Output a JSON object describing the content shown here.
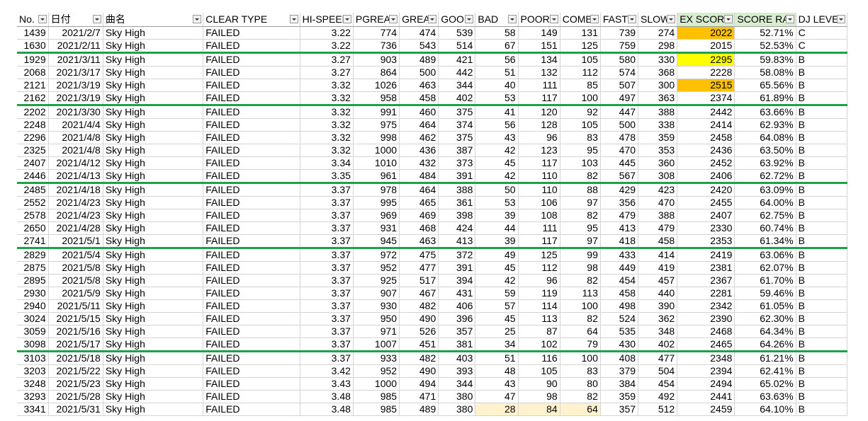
{
  "columns": [
    "No.",
    "日付",
    "曲名",
    "CLEAR TYPE",
    "HI-SPEED",
    "PGREAT",
    "GREAT",
    "GOOD",
    "BAD",
    "POOR",
    "COMBO",
    "FAST",
    "SLOW",
    "EX SCORE",
    "SCORE RATE",
    "DJ LEVEL"
  ],
  "group_separators_after_row": [
    1,
    5,
    11,
    16,
    24
  ],
  "highlight_colors": {
    "orange": "#ffc000",
    "yellow": "#ffff00",
    "cream": "#fff2cc",
    "separator": "#1fa04e",
    "header_green": "#d8ecd0"
  },
  "rows": [
    {
      "no": "1439",
      "date": "2021/2/7",
      "song": "Sky High",
      "clear": "FAILED",
      "hs": "3.22",
      "pg": "774",
      "gr": "474",
      "gd": "539",
      "bd": "58",
      "pr": "149",
      "cb": "131",
      "fast": "739",
      "slow": "274",
      "ex": "2022",
      "rate": "52.71%",
      "dj": "C",
      "ex_hl": "orange"
    },
    {
      "no": "1630",
      "date": "2021/2/11",
      "song": "Sky High",
      "clear": "FAILED",
      "hs": "3.22",
      "pg": "736",
      "gr": "543",
      "gd": "514",
      "bd": "67",
      "pr": "151",
      "cb": "125",
      "fast": "759",
      "slow": "298",
      "ex": "2015",
      "rate": "52.53%",
      "dj": "C"
    },
    {
      "no": "1929",
      "date": "2021/3/11",
      "song": "Sky High",
      "clear": "FAILED",
      "hs": "3.27",
      "pg": "903",
      "gr": "489",
      "gd": "421",
      "bd": "56",
      "pr": "134",
      "cb": "105",
      "fast": "580",
      "slow": "330",
      "ex": "2295",
      "rate": "59.83%",
      "dj": "B",
      "ex_hl": "yellow"
    },
    {
      "no": "2068",
      "date": "2021/3/17",
      "song": "Sky High",
      "clear": "FAILED",
      "hs": "3.27",
      "pg": "864",
      "gr": "500",
      "gd": "442",
      "bd": "51",
      "pr": "132",
      "cb": "112",
      "fast": "574",
      "slow": "368",
      "ex": "2228",
      "rate": "58.08%",
      "dj": "B"
    },
    {
      "no": "2121",
      "date": "2021/3/19",
      "song": "Sky High",
      "clear": "FAILED",
      "hs": "3.32",
      "pg": "1026",
      "gr": "463",
      "gd": "344",
      "bd": "40",
      "pr": "111",
      "cb": "85",
      "fast": "507",
      "slow": "300",
      "ex": "2515",
      "rate": "65.56%",
      "dj": "B",
      "ex_hl": "orange"
    },
    {
      "no": "2162",
      "date": "2021/3/19",
      "song": "Sky High",
      "clear": "FAILED",
      "hs": "3.32",
      "pg": "958",
      "gr": "458",
      "gd": "402",
      "bd": "53",
      "pr": "117",
      "cb": "100",
      "fast": "497",
      "slow": "363",
      "ex": "2374",
      "rate": "61.89%",
      "dj": "B"
    },
    {
      "no": "2202",
      "date": "2021/3/30",
      "song": "Sky High",
      "clear": "FAILED",
      "hs": "3.32",
      "pg": "991",
      "gr": "460",
      "gd": "375",
      "bd": "41",
      "pr": "120",
      "cb": "92",
      "fast": "447",
      "slow": "388",
      "ex": "2442",
      "rate": "63.66%",
      "dj": "B"
    },
    {
      "no": "2248",
      "date": "2021/4/4",
      "song": "Sky High",
      "clear": "FAILED",
      "hs": "3.32",
      "pg": "975",
      "gr": "464",
      "gd": "374",
      "bd": "56",
      "pr": "128",
      "cb": "105",
      "fast": "500",
      "slow": "338",
      "ex": "2414",
      "rate": "62.93%",
      "dj": "B"
    },
    {
      "no": "2296",
      "date": "2021/4/8",
      "song": "Sky High",
      "clear": "FAILED",
      "hs": "3.32",
      "pg": "998",
      "gr": "462",
      "gd": "375",
      "bd": "43",
      "pr": "96",
      "cb": "83",
      "fast": "478",
      "slow": "359",
      "ex": "2458",
      "rate": "64.08%",
      "dj": "B"
    },
    {
      "no": "2325",
      "date": "2021/4/8",
      "song": "Sky High",
      "clear": "FAILED",
      "hs": "3.32",
      "pg": "1000",
      "gr": "436",
      "gd": "387",
      "bd": "42",
      "pr": "123",
      "cb": "95",
      "fast": "470",
      "slow": "353",
      "ex": "2436",
      "rate": "63.50%",
      "dj": "B"
    },
    {
      "no": "2407",
      "date": "2021/4/12",
      "song": "Sky High",
      "clear": "FAILED",
      "hs": "3.34",
      "pg": "1010",
      "gr": "432",
      "gd": "373",
      "bd": "45",
      "pr": "117",
      "cb": "103",
      "fast": "445",
      "slow": "360",
      "ex": "2452",
      "rate": "63.92%",
      "dj": "B"
    },
    {
      "no": "2446",
      "date": "2021/4/13",
      "song": "Sky High",
      "clear": "FAILED",
      "hs": "3.35",
      "pg": "961",
      "gr": "484",
      "gd": "391",
      "bd": "42",
      "pr": "110",
      "cb": "82",
      "fast": "567",
      "slow": "308",
      "ex": "2406",
      "rate": "62.72%",
      "dj": "B"
    },
    {
      "no": "2485",
      "date": "2021/4/18",
      "song": "Sky High",
      "clear": "FAILED",
      "hs": "3.37",
      "pg": "978",
      "gr": "464",
      "gd": "388",
      "bd": "50",
      "pr": "110",
      "cb": "88",
      "fast": "429",
      "slow": "423",
      "ex": "2420",
      "rate": "63.09%",
      "dj": "B"
    },
    {
      "no": "2552",
      "date": "2021/4/23",
      "song": "Sky High",
      "clear": "FAILED",
      "hs": "3.37",
      "pg": "995",
      "gr": "465",
      "gd": "361",
      "bd": "53",
      "pr": "106",
      "cb": "97",
      "fast": "356",
      "slow": "470",
      "ex": "2455",
      "rate": "64.00%",
      "dj": "B"
    },
    {
      "no": "2578",
      "date": "2021/4/23",
      "song": "Sky High",
      "clear": "FAILED",
      "hs": "3.37",
      "pg": "969",
      "gr": "469",
      "gd": "398",
      "bd": "39",
      "pr": "108",
      "cb": "82",
      "fast": "479",
      "slow": "388",
      "ex": "2407",
      "rate": "62.75%",
      "dj": "B"
    },
    {
      "no": "2650",
      "date": "2021/4/28",
      "song": "Sky High",
      "clear": "FAILED",
      "hs": "3.37",
      "pg": "931",
      "gr": "468",
      "gd": "424",
      "bd": "44",
      "pr": "111",
      "cb": "95",
      "fast": "413",
      "slow": "479",
      "ex": "2330",
      "rate": "60.74%",
      "dj": "B"
    },
    {
      "no": "2741",
      "date": "2021/5/1",
      "song": "Sky High",
      "clear": "FAILED",
      "hs": "3.37",
      "pg": "945",
      "gr": "463",
      "gd": "413",
      "bd": "39",
      "pr": "117",
      "cb": "97",
      "fast": "418",
      "slow": "458",
      "ex": "2353",
      "rate": "61.34%",
      "dj": "B"
    },
    {
      "no": "2829",
      "date": "2021/5/4",
      "song": "Sky High",
      "clear": "FAILED",
      "hs": "3.37",
      "pg": "972",
      "gr": "475",
      "gd": "372",
      "bd": "49",
      "pr": "125",
      "cb": "99",
      "fast": "433",
      "slow": "414",
      "ex": "2419",
      "rate": "63.06%",
      "dj": "B"
    },
    {
      "no": "2875",
      "date": "2021/5/8",
      "song": "Sky High",
      "clear": "FAILED",
      "hs": "3.37",
      "pg": "952",
      "gr": "477",
      "gd": "391",
      "bd": "45",
      "pr": "112",
      "cb": "98",
      "fast": "449",
      "slow": "419",
      "ex": "2381",
      "rate": "62.07%",
      "dj": "B"
    },
    {
      "no": "2895",
      "date": "2021/5/8",
      "song": "Sky High",
      "clear": "FAILED",
      "hs": "3.37",
      "pg": "925",
      "gr": "517",
      "gd": "394",
      "bd": "42",
      "pr": "96",
      "cb": "82",
      "fast": "454",
      "slow": "457",
      "ex": "2367",
      "rate": "61.70%",
      "dj": "B"
    },
    {
      "no": "2930",
      "date": "2021/5/9",
      "song": "Sky High",
      "clear": "FAILED",
      "hs": "3.37",
      "pg": "907",
      "gr": "467",
      "gd": "431",
      "bd": "59",
      "pr": "119",
      "cb": "113",
      "fast": "458",
      "slow": "440",
      "ex": "2281",
      "rate": "59.46%",
      "dj": "B"
    },
    {
      "no": "2940",
      "date": "2021/5/11",
      "song": "Sky High",
      "clear": "FAILED",
      "hs": "3.37",
      "pg": "930",
      "gr": "482",
      "gd": "406",
      "bd": "57",
      "pr": "114",
      "cb": "100",
      "fast": "498",
      "slow": "390",
      "ex": "2342",
      "rate": "61.05%",
      "dj": "B"
    },
    {
      "no": "3024",
      "date": "2021/5/15",
      "song": "Sky High",
      "clear": "FAILED",
      "hs": "3.37",
      "pg": "950",
      "gr": "490",
      "gd": "396",
      "bd": "45",
      "pr": "113",
      "cb": "82",
      "fast": "524",
      "slow": "362",
      "ex": "2390",
      "rate": "62.30%",
      "dj": "B"
    },
    {
      "no": "3059",
      "date": "2021/5/16",
      "song": "Sky High",
      "clear": "FAILED",
      "hs": "3.37",
      "pg": "971",
      "gr": "526",
      "gd": "357",
      "bd": "25",
      "pr": "87",
      "cb": "64",
      "fast": "535",
      "slow": "348",
      "ex": "2468",
      "rate": "64.34%",
      "dj": "B"
    },
    {
      "no": "3098",
      "date": "2021/5/17",
      "song": "Sky High",
      "clear": "FAILED",
      "hs": "3.37",
      "pg": "1007",
      "gr": "451",
      "gd": "381",
      "bd": "34",
      "pr": "102",
      "cb": "79",
      "fast": "430",
      "slow": "402",
      "ex": "2465",
      "rate": "64.26%",
      "dj": "B"
    },
    {
      "no": "3103",
      "date": "2021/5/18",
      "song": "Sky High",
      "clear": "FAILED",
      "hs": "3.37",
      "pg": "933",
      "gr": "482",
      "gd": "403",
      "bd": "51",
      "pr": "116",
      "cb": "100",
      "fast": "408",
      "slow": "477",
      "ex": "2348",
      "rate": "61.21%",
      "dj": "B"
    },
    {
      "no": "3203",
      "date": "2021/5/22",
      "song": "Sky High",
      "clear": "FAILED",
      "hs": "3.42",
      "pg": "952",
      "gr": "490",
      "gd": "393",
      "bd": "48",
      "pr": "105",
      "cb": "83",
      "fast": "379",
      "slow": "504",
      "ex": "2394",
      "rate": "62.41%",
      "dj": "B"
    },
    {
      "no": "3248",
      "date": "2021/5/23",
      "song": "Sky High",
      "clear": "FAILED",
      "hs": "3.43",
      "pg": "1000",
      "gr": "494",
      "gd": "344",
      "bd": "43",
      "pr": "90",
      "cb": "80",
      "fast": "384",
      "slow": "454",
      "ex": "2494",
      "rate": "65.02%",
      "dj": "B"
    },
    {
      "no": "3293",
      "date": "2021/5/28",
      "song": "Sky High",
      "clear": "FAILED",
      "hs": "3.48",
      "pg": "985",
      "gr": "471",
      "gd": "380",
      "bd": "47",
      "pr": "98",
      "cb": "82",
      "fast": "359",
      "slow": "492",
      "ex": "2441",
      "rate": "63.63%",
      "dj": "B"
    },
    {
      "no": "3341",
      "date": "2021/5/31",
      "song": "Sky High",
      "clear": "FAILED",
      "hs": "3.48",
      "pg": "985",
      "gr": "489",
      "gd": "380",
      "bd": "28",
      "pr": "84",
      "cb": "64",
      "fast": "357",
      "slow": "512",
      "ex": "2459",
      "rate": "64.10%",
      "dj": "B",
      "bpc_hl": "cream"
    }
  ]
}
